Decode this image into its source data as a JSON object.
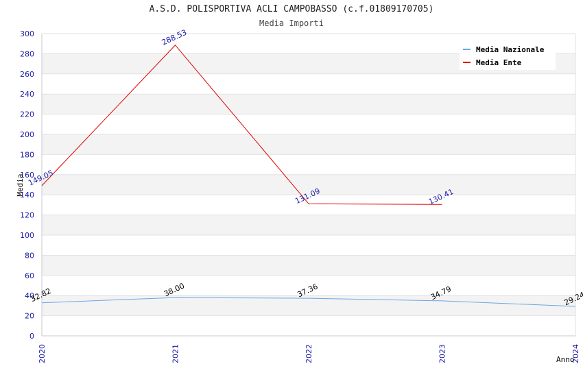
{
  "chart_data": {
    "type": "line",
    "title": "A.S.D. POLISPORTIVA ACLI CAMPOBASSO (c.f.01809170705)",
    "subtitle": "Media Importi",
    "xlabel": "Anno",
    "ylabel": "Media",
    "categories": [
      "2020",
      "2021",
      "2022",
      "2023",
      "2024"
    ],
    "ylim": [
      0,
      300
    ],
    "yticks": [
      0,
      20,
      40,
      60,
      80,
      100,
      120,
      140,
      160,
      180,
      200,
      220,
      240,
      260,
      280,
      300
    ],
    "grid": true,
    "legend_position": "top-right",
    "series": [
      {
        "name": "Media Nazionale",
        "color": "#6aa6e6",
        "label_color": "#000000",
        "values": [
          32.82,
          38.0,
          37.36,
          34.79,
          29.24
        ],
        "labels": [
          "32.82",
          "38.00",
          "37.36",
          "34.79",
          "29.24"
        ]
      },
      {
        "name": "Media Ente",
        "color": "#e00000",
        "label_color": "#1a1aa6",
        "values": [
          149.05,
          288.53,
          131.09,
          130.41,
          null
        ],
        "labels": [
          "149.05",
          "288.53",
          "131.09",
          "130.41",
          null
        ]
      }
    ]
  }
}
